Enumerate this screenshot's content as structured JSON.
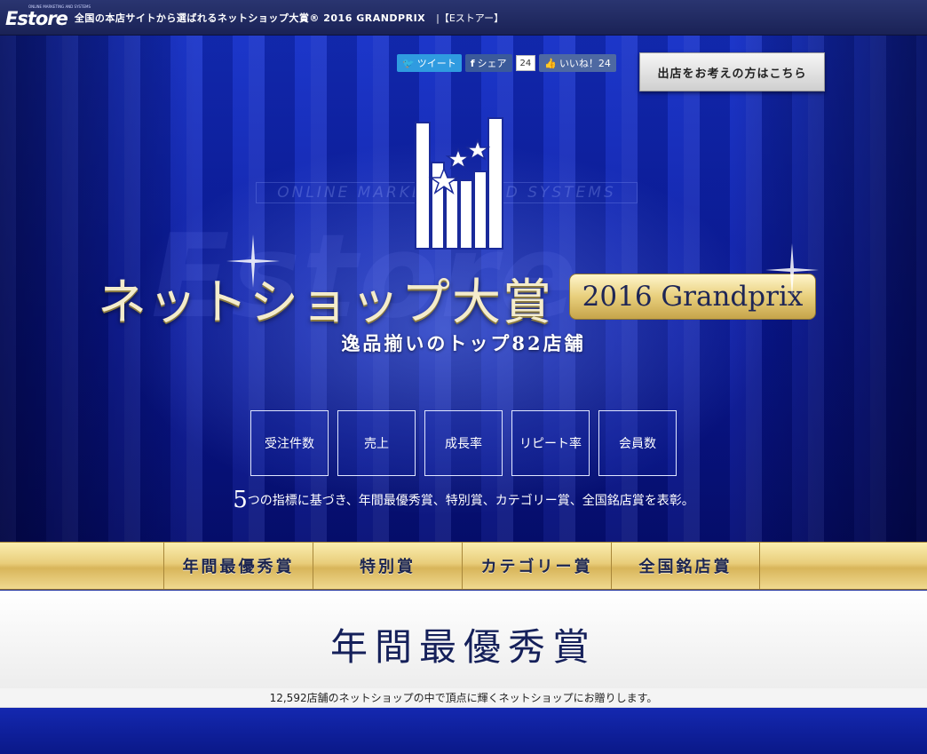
{
  "header": {
    "logo_text": "Estore",
    "logo_subtext": "ONLINE MARKETING AND SYSTEMS",
    "tagline": "全国の本店サイトから選ばれるネットショップ大賞® 2016 GRANDPRIX",
    "brand_suffix": "|【Eストアー】"
  },
  "social": {
    "tweet_label": "ツイート",
    "share_label": "シェア",
    "share_count": "24",
    "like_label": "いいね！24"
  },
  "shop_button_label": "出店をお考えの方はこちら",
  "hero": {
    "watermark": "ONLINE MARKETING AND SYSTEMS",
    "watermark_big": "Estore",
    "title": "ネットショップ大賞",
    "badge": "2016 Grandprix",
    "subtitle": "逸品揃いのトップ82店舗",
    "metrics": [
      "受注件数",
      "売上",
      "成長率",
      "リピート率",
      "会員数"
    ],
    "caption_lead": "5",
    "caption_rest": "つの指標に基づき、年間最優秀賞、特別賞、カテゴリー賞、全国銘店賞を表彰。"
  },
  "nav_tabs": [
    "年間最優秀賞",
    "特別賞",
    "カテゴリー賞",
    "全国銘店賞"
  ],
  "section": {
    "title": "年間最優秀賞",
    "note": "12,592店舗のネットショップの中で頂点に輝くネットショップにお贈りします。"
  },
  "colors": {
    "navy": "#15205a",
    "gold": "#e8cd7a",
    "hero_blue": "#1530c8"
  }
}
